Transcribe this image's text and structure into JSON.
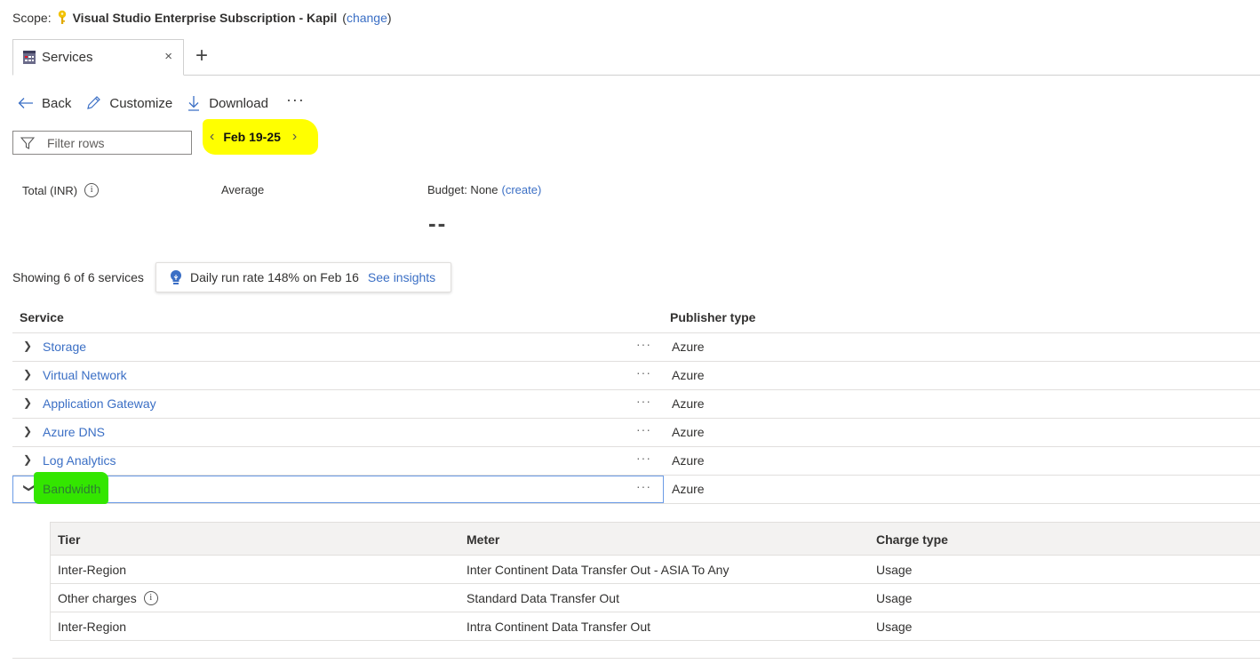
{
  "scope": {
    "label": "Scope:",
    "subscription": "Visual Studio Enterprise Subscription - Kapil",
    "change_open": "(",
    "change_link": "change",
    "change_close": ")",
    "icon": "key-icon"
  },
  "tabs": [
    {
      "label": "Services",
      "icon": "cost-analysis-icon",
      "close": "×"
    }
  ],
  "add_tab": "+",
  "toolbar": {
    "back": "Back",
    "customize": "Customize",
    "download": "Download",
    "more": "···"
  },
  "filter": {
    "placeholder": "Filter rows",
    "value": ""
  },
  "date_range": {
    "label": "Feb 19-25",
    "prev": "‹",
    "next": "›",
    "highlight_color": "#ffff00"
  },
  "kpis": {
    "total_label": "Total (INR)",
    "average_label": "Average",
    "budget_label": "Budget: None",
    "budget_link": "(create)",
    "value_placeholder": "--"
  },
  "summary": {
    "showing": "Showing 6 of 6 services",
    "insight_text": "Daily run rate 148% on Feb 16",
    "insight_link": "See insights"
  },
  "services_table": {
    "columns": [
      "Service",
      "Publisher type"
    ],
    "rows": [
      {
        "service": "Storage",
        "publisher": "Azure",
        "expanded": false
      },
      {
        "service": "Virtual Network",
        "publisher": "Azure",
        "expanded": false
      },
      {
        "service": "Application Gateway",
        "publisher": "Azure",
        "expanded": false
      },
      {
        "service": "Azure DNS",
        "publisher": "Azure",
        "expanded": false
      },
      {
        "service": "Log Analytics",
        "publisher": "Azure",
        "expanded": false
      },
      {
        "service": "Bandwidth",
        "publisher": "Azure",
        "expanded": true
      }
    ],
    "row_more": "···",
    "highlight_color": "#33e600"
  },
  "bandwidth_detail": {
    "columns": [
      "Tier",
      "Meter",
      "Charge type"
    ],
    "rows": [
      {
        "tier": "Inter-Region",
        "meter": "Inter Continent Data Transfer Out - ASIA To Any",
        "charge": "Usage",
        "info": false
      },
      {
        "tier": "Other charges",
        "meter": "Standard Data Transfer Out",
        "charge": "Usage",
        "info": true
      },
      {
        "tier": "Inter-Region",
        "meter": "Intra Continent Data Transfer Out",
        "charge": "Usage",
        "info": false
      }
    ]
  },
  "colors": {
    "link": "#3b6fc5",
    "text": "#323130",
    "border": "#e1dfdd"
  }
}
